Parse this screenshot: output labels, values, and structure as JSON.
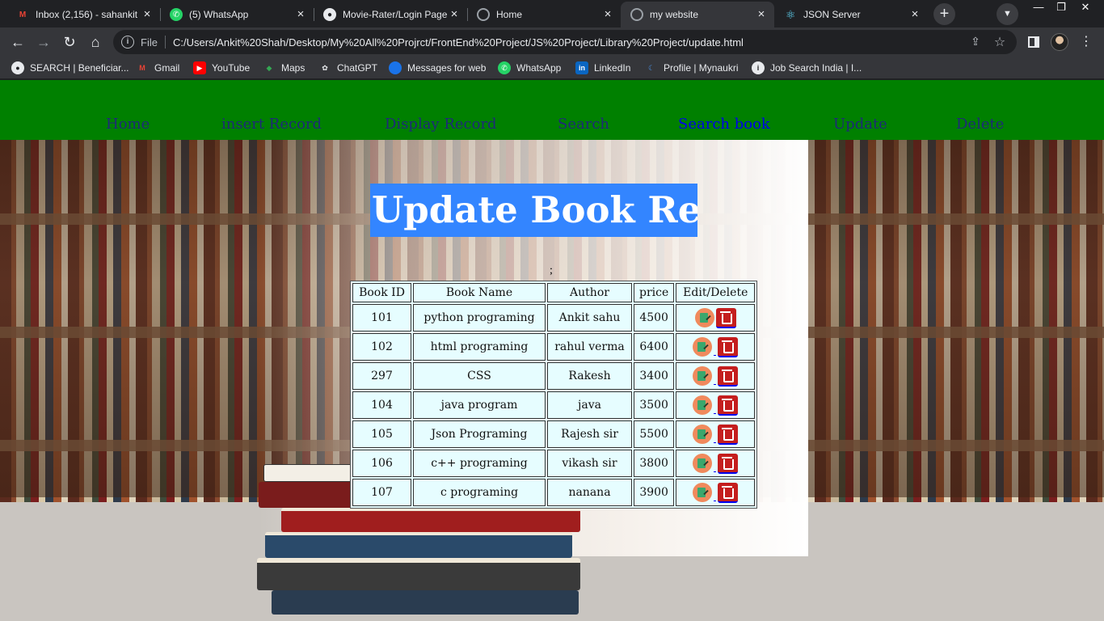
{
  "browser": {
    "tabs": [
      {
        "label": "Inbox (2,156) - sahankit",
        "icon": "gmail-icon",
        "color": "#ea4335"
      },
      {
        "label": "(5) WhatsApp",
        "icon": "whatsapp-icon",
        "color": "#25d366"
      },
      {
        "label": "Movie-Rater/Login Page",
        "icon": "github-icon",
        "color": "#ffffff"
      },
      {
        "label": "Home",
        "icon": "globe-icon",
        "color": "#9aa0a6"
      },
      {
        "label": "my website",
        "icon": "globe-icon",
        "color": "#9aa0a6",
        "active": true
      },
      {
        "label": "JSON Server",
        "icon": "react-icon",
        "color": "#61dafb"
      }
    ],
    "omnibox": {
      "scheme_label": "File",
      "url": "C:/Users/Ankit%20Shah/Desktop/My%20All%20Projrct/FrontEnd%20Project/JS%20Project/Library%20Project/update.html"
    },
    "bookmarks": [
      {
        "label": "SEARCH | Beneficiar...",
        "icon": "github-icon"
      },
      {
        "label": "Gmail",
        "icon": "gmail-icon"
      },
      {
        "label": "YouTube",
        "icon": "youtube-icon"
      },
      {
        "label": "Maps",
        "icon": "maps-icon"
      },
      {
        "label": "ChatGPT",
        "icon": "chatgpt-icon"
      },
      {
        "label": "Messages for web",
        "icon": "messages-icon"
      },
      {
        "label": "WhatsApp",
        "icon": "whatsapp-icon"
      },
      {
        "label": "LinkedIn",
        "icon": "linkedin-icon"
      },
      {
        "label": "Profile | Mynaukri",
        "icon": "naukri-icon"
      },
      {
        "label": "Job Search India | I...",
        "icon": "indeed-icon"
      }
    ]
  },
  "nav": {
    "links": [
      "Home",
      "insert Record",
      "Display Record",
      "Search",
      "Search book",
      "Update",
      "Delete"
    ],
    "active": "Search book",
    "bar_color": "#008000"
  },
  "main": {
    "heading": "Update Book Recor",
    "stray_text": ";",
    "table": {
      "headers": [
        "Book ID",
        "Book Name",
        "Author",
        "price",
        "Edit/Delete"
      ],
      "rows": [
        [
          "101",
          "python programing",
          "Ankit sahu",
          "4500"
        ],
        [
          "102",
          "html programing",
          "rahul verma",
          "6400"
        ],
        [
          "297",
          "CSS",
          "Rakesh",
          "3400"
        ],
        [
          "104",
          "java program",
          "java",
          "3500"
        ],
        [
          "105",
          "Json Programing",
          "Rajesh sir",
          "5500"
        ],
        [
          "106",
          "c++ programing",
          "vikash sir",
          "3800"
        ],
        [
          "107",
          "c programing",
          "nanana",
          "3900"
        ]
      ]
    }
  }
}
